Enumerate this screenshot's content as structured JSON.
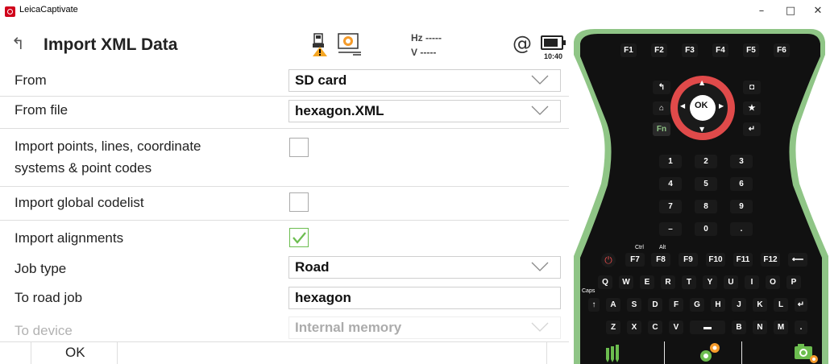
{
  "window": {
    "app_title": "LeicaCaptivate",
    "minimize": "–",
    "maximize": "□",
    "close": "✕"
  },
  "header": {
    "title": "Import XML Data",
    "hz_label": "Hz -----",
    "v_label": "V   -----",
    "at_symbol": "@",
    "time": "10:40"
  },
  "form": {
    "from_label": "From",
    "from_value": "SD card",
    "from_file_label": "From file",
    "from_file_value": "hexagon.XML",
    "import_points_label_1": "Import points, lines, coordinate",
    "import_points_label_2": "systems & point codes",
    "import_codelist_label": "Import global codelist",
    "import_alignments_label": "Import alignments",
    "job_type_label": "Job type",
    "job_type_value": "Road",
    "to_road_job_label": "To road job",
    "to_road_job_value": "hexagon",
    "to_device_label": "To device",
    "to_device_value": "Internal memory"
  },
  "footer": {
    "ok_label": "OK"
  },
  "keyboard": {
    "fkeys_top": [
      "F1",
      "F2",
      "F3",
      "F4",
      "F5",
      "F6"
    ],
    "ok_label": "OK",
    "fn_label": "Fn",
    "numpad": [
      "1",
      "2",
      "3",
      "4",
      "5",
      "6",
      "7",
      "8",
      "9",
      "–",
      "0",
      "."
    ],
    "fkeys_bottom": [
      "F7",
      "F8",
      "F9",
      "F10",
      "F11",
      "F12"
    ],
    "row_q": [
      "Q",
      "W",
      "E",
      "R",
      "T",
      "Y",
      "U",
      "I",
      "O",
      "P"
    ],
    "row_a": [
      "A",
      "S",
      "D",
      "F",
      "G",
      "H",
      "J",
      "K",
      "L"
    ],
    "row_z": [
      "Z",
      "X",
      "C",
      "V",
      "B",
      "N",
      "M"
    ],
    "ctrl_label": "Ctrl",
    "alt_label": "Alt",
    "caps_label": "Caps"
  },
  "colors": {
    "accent_green": "#6cbd4f",
    "keyboard_body": "#111111",
    "keyboard_trim": "#8fc586",
    "nav_ring": "#e04a4a"
  }
}
